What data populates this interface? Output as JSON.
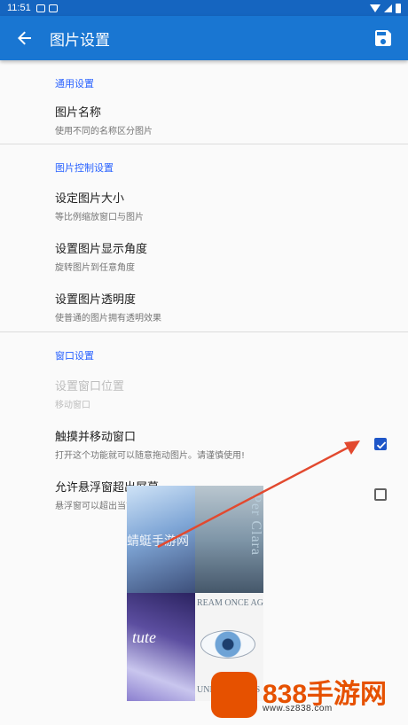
{
  "status_bar": {
    "time": "11:51"
  },
  "app_bar": {
    "title": "图片设置",
    "back_icon": "arrow-back-icon",
    "save_icon": "save-icon",
    "color": "#1976d2"
  },
  "sections": {
    "general": {
      "header": "通用设置",
      "image_name": {
        "title": "图片名称",
        "summary": "使用不同的名称区分图片"
      }
    },
    "image_control": {
      "header": "图片控制设置",
      "size": {
        "title": "设定图片大小",
        "summary": "等比例缩放窗口与图片"
      },
      "angle": {
        "title": "设置图片显示角度",
        "summary": "旋转图片到任意角度"
      },
      "opacity": {
        "title": "设置图片透明度",
        "summary": "使普通的图片拥有透明效果"
      }
    },
    "window": {
      "header": "窗口设置",
      "position": {
        "title": "设置窗口位置",
        "summary": "移动窗口",
        "enabled": false
      },
      "touch_move": {
        "title": "触摸并移动窗口",
        "summary": "打开这个功能就可以随意拖动图片。请谨慎使用!",
        "checked": true
      },
      "allow_outside": {
        "title": "允许悬浮窗超出屏幕",
        "summary": "悬浮窗可以超出当前可显示的屏幕外",
        "checked": false
      }
    }
  },
  "floating_image": {
    "watermark": "蜻蜓手游网",
    "top_right_text": "Per Clara",
    "mid_text": "REAM ONCE AGA",
    "bottom_text": "UNDO ... ESTAS",
    "script_text": "tute"
  },
  "site_logo": {
    "text": "838手游网",
    "url": "www.sz838.com"
  },
  "accent": "#2962ff",
  "checkbox_color": "#1e56c8",
  "arrow_color": "#e2492f"
}
